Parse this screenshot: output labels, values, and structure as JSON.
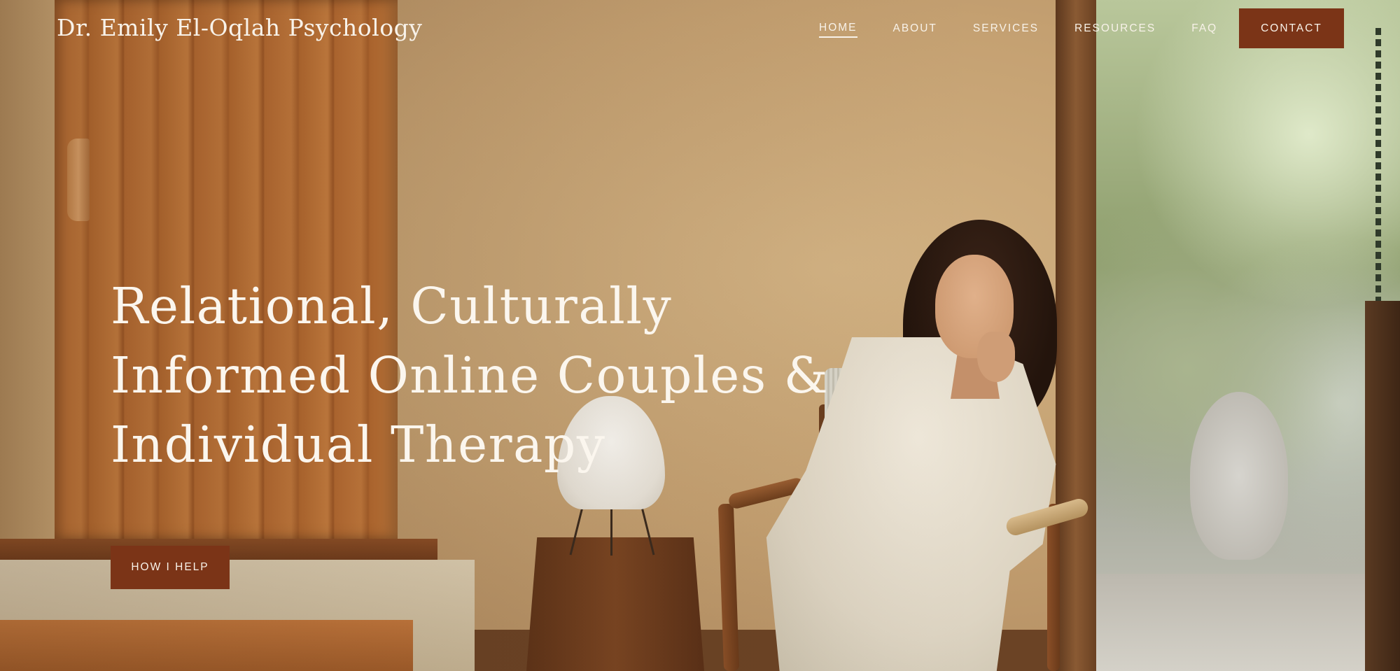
{
  "site": {
    "title": "Dr. Emily El-Oqlah Psychology"
  },
  "nav": {
    "items": [
      {
        "label": "HOME",
        "active": true
      },
      {
        "label": "ABOUT",
        "active": false
      },
      {
        "label": "SERVICES",
        "active": false
      },
      {
        "label": "RESOURCES",
        "active": false
      },
      {
        "label": "FAQ",
        "active": false
      }
    ],
    "contact_label": "CONTACT"
  },
  "hero": {
    "headline_lines": [
      "Relational, Culturally",
      "Informed Online Couples &",
      "Individual Therapy"
    ],
    "cta_label": "HOW I HELP",
    "photo": "therapist-seated-in-chair-photo"
  },
  "colors": {
    "accent": "#7b3417",
    "text_light": "#f8f2e9",
    "wall": "#c4a071"
  }
}
